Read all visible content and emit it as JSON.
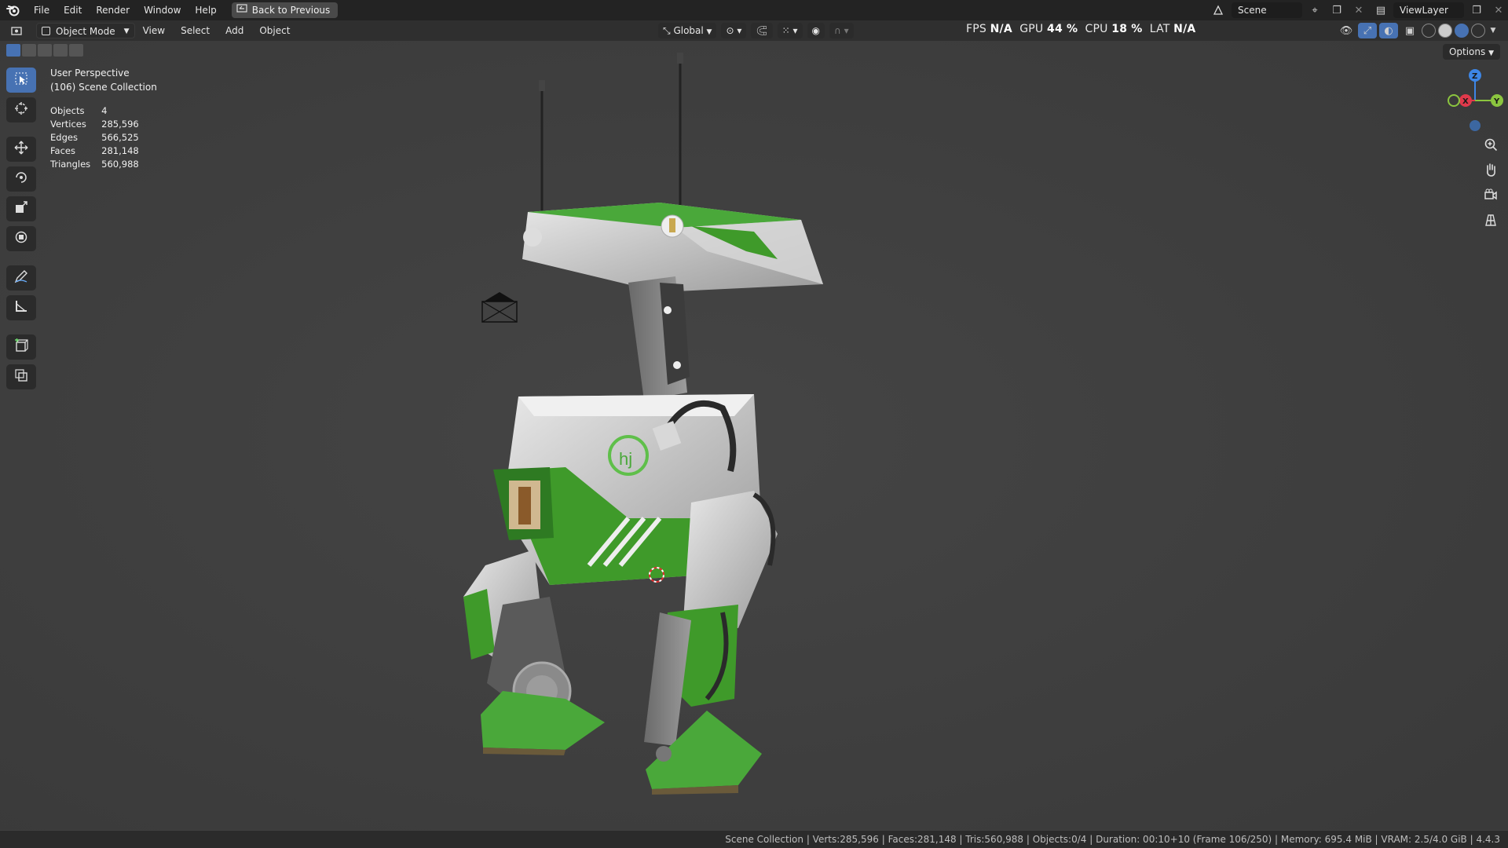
{
  "menubar": {
    "items": [
      "File",
      "Edit",
      "Render",
      "Window",
      "Help"
    ],
    "back_button": "Back to Previous",
    "scene_name": "Scene",
    "view_layer": "ViewLayer"
  },
  "viewport_header": {
    "mode": "Object Mode",
    "menus": [
      "View",
      "Select",
      "Add",
      "Object"
    ],
    "transform_orientation": "Global",
    "fps_label": "FPS",
    "fps_value": "N/A",
    "gpu_label": "GPU",
    "gpu_value": "44 %",
    "cpu_label": "CPU",
    "cpu_value": "18 %",
    "lat_label": "LAT",
    "lat_value": "N/A"
  },
  "overlay": {
    "view_name": "User Perspective",
    "collection": "(106) Scene Collection",
    "stats": [
      {
        "label": "Objects",
        "value": "4"
      },
      {
        "label": "Vertices",
        "value": "285,596"
      },
      {
        "label": "Edges",
        "value": "566,525"
      },
      {
        "label": "Faces",
        "value": "281,148"
      },
      {
        "label": "Triangles",
        "value": "560,988"
      }
    ]
  },
  "options_label": "Options",
  "gizmo": {
    "x": "X",
    "y": "Y",
    "z": "Z"
  },
  "statusbar": {
    "text": "Scene Collection | Verts:285,596 | Faces:281,148 | Tris:560,988 | Objects:0/4 | Duration: 00:10+10 (Frame 106/250) | Memory: 695.4 MiB | VRAM: 2.5/4.0 GiB | 4.4.3"
  },
  "colors": {
    "accent": "#4772b3",
    "robot_green": "#3f9a2a",
    "axis_x": "#e0394b",
    "axis_y": "#8bc53f",
    "axis_z": "#3d86e6"
  }
}
